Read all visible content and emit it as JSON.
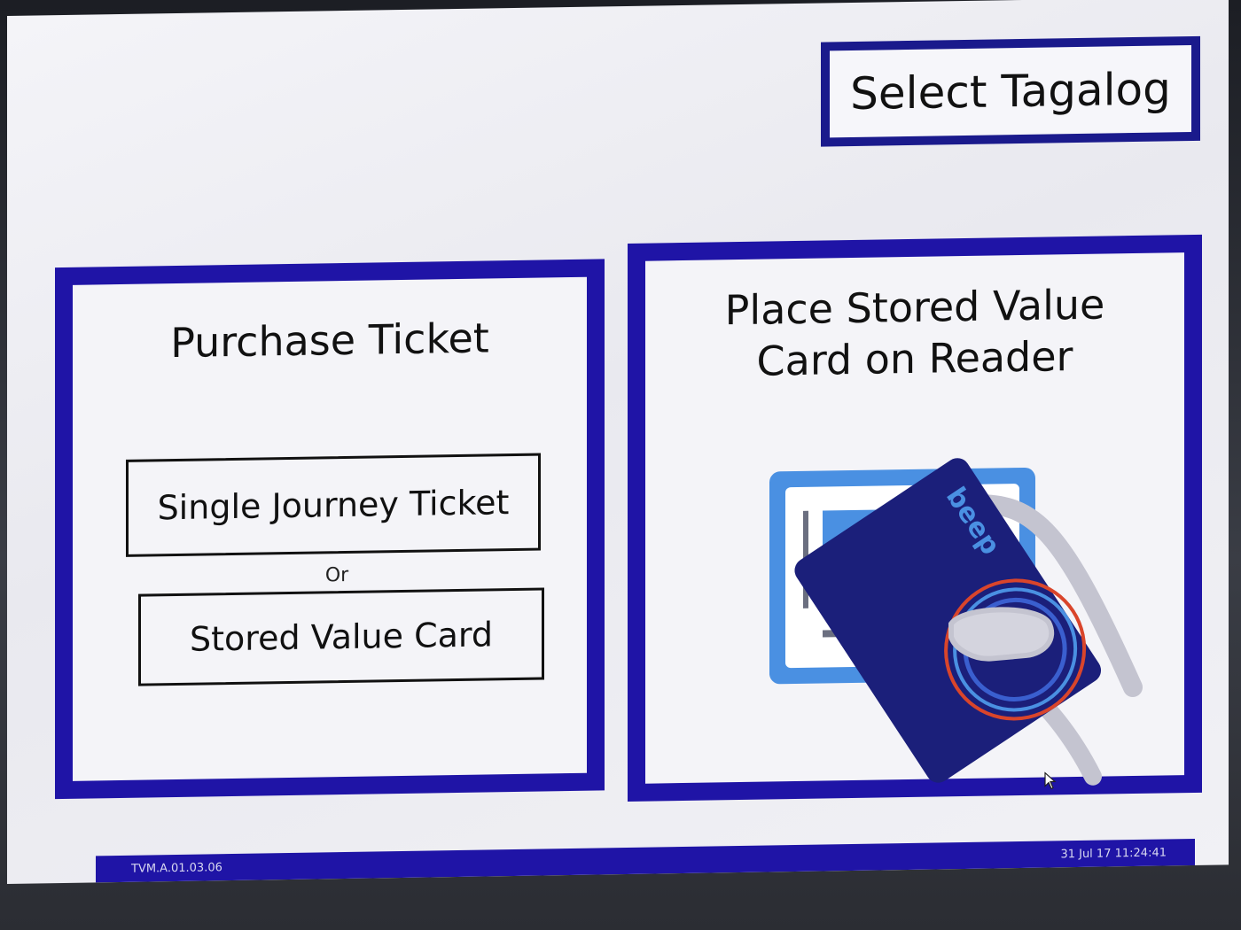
{
  "language_button": {
    "label": "Select Tagalog"
  },
  "purchase_panel": {
    "title": "Purchase Ticket",
    "options": [
      {
        "label": "Single Journey Ticket"
      },
      {
        "label": "Stored Value Card"
      }
    ],
    "separator": "Or"
  },
  "card_panel": {
    "title_line1": "Place Stored Value",
    "title_line2": "Card on Reader",
    "card_brand": "beep"
  },
  "status_bar": {
    "version": "TVM.A.01.03.06",
    "datetime": "31 Jul 17 11:24:41"
  },
  "colors": {
    "panel_border": "#1f14a6",
    "card_blue": "#1b1f7a",
    "reader_blue": "#4a90e2"
  }
}
